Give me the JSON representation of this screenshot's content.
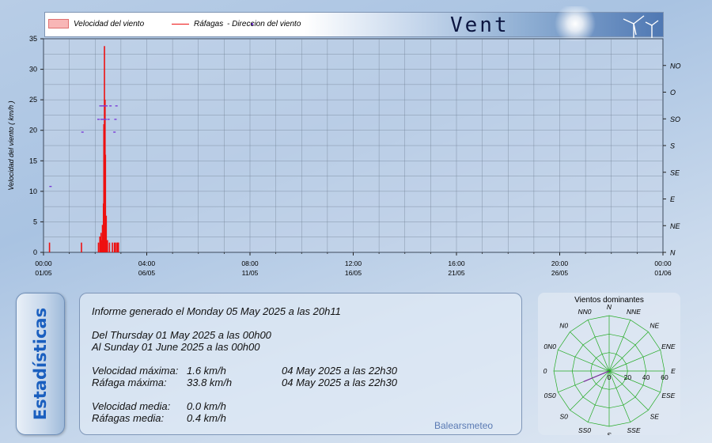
{
  "header": {
    "title": "Vent",
    "legend": {
      "speed_label": "Velocidad del viento",
      "gust_label": "Ráfagas",
      "dir_label": "- Direccion del viento"
    }
  },
  "colors": {
    "speed": "#f4a0a0",
    "gust": "#ee1111",
    "direction": "#7a3cd8",
    "grid": "#6f7f93",
    "rose_grid": "#22aa22",
    "rose_fill": "#c88bb8",
    "title_accent": "#1a5fbf"
  },
  "chart_data": [
    {
      "type": "bar",
      "ylabel": "Velocidad del viento ( km/h )",
      "ylim": [
        0,
        35
      ],
      "y_ticks": [
        "0",
        "5",
        "10",
        "15",
        "20",
        "25",
        "30",
        "35"
      ],
      "x_ticks": [
        {
          "time": "00:00",
          "date": "01/05"
        },
        {
          "time": "04:00",
          "date": "06/05"
        },
        {
          "time": "08:00",
          "date": "11/05"
        },
        {
          "time": "12:00",
          "date": "16/05"
        },
        {
          "time": "16:00",
          "date": "21/05"
        },
        {
          "time": "20:00",
          "date": "26/05"
        },
        {
          "time": "00:00",
          "date": "01/06"
        }
      ],
      "x_range_days": [
        0,
        31
      ],
      "right_axis_labels": [
        "N",
        "NE",
        "E",
        "SE",
        "S",
        "SO",
        "O",
        "NO"
      ],
      "grid": true,
      "gusts": [
        {
          "day": 0.3,
          "value": 1.6
        },
        {
          "day": 1.9,
          "value": 1.6
        },
        {
          "day": 2.75,
          "value": 1.6
        },
        {
          "day": 2.82,
          "value": 2.6
        },
        {
          "day": 2.88,
          "value": 3.2
        },
        {
          "day": 2.92,
          "value": 2.0
        },
        {
          "day": 2.95,
          "value": 4.5
        },
        {
          "day": 3.0,
          "value": 8.0
        },
        {
          "day": 3.02,
          "value": 21.0
        },
        {
          "day": 3.05,
          "value": 33.8
        },
        {
          "day": 3.08,
          "value": 25.0
        },
        {
          "day": 3.1,
          "value": 16.0
        },
        {
          "day": 3.14,
          "value": 6.0
        },
        {
          "day": 3.2,
          "value": 2.0
        },
        {
          "day": 3.3,
          "value": 1.6
        },
        {
          "day": 3.45,
          "value": 1.6
        },
        {
          "day": 3.55,
          "value": 1.6
        },
        {
          "day": 3.6,
          "value": 1.6
        },
        {
          "day": 3.68,
          "value": 1.6
        },
        {
          "day": 3.72,
          "value": 1.6
        },
        {
          "day": 3.75,
          "value": 1.6
        }
      ],
      "speed": [
        {
          "day": 3.02,
          "value": 1.2
        },
        {
          "day": 3.05,
          "value": 1.6
        },
        {
          "day": 3.08,
          "value": 1.0
        }
      ],
      "direction_points": [
        {
          "day": 0.35,
          "value": 10.8
        },
        {
          "day": 1.95,
          "value": 19.7
        },
        {
          "day": 2.75,
          "value": 21.8
        },
        {
          "day": 2.85,
          "value": 24.0
        },
        {
          "day": 2.9,
          "value": 21.8
        },
        {
          "day": 2.95,
          "value": 24.0
        },
        {
          "day": 3.0,
          "value": 21.8
        },
        {
          "day": 3.05,
          "value": 24.0
        },
        {
          "day": 3.1,
          "value": 21.8
        },
        {
          "day": 3.15,
          "value": 24.0
        },
        {
          "day": 3.25,
          "value": 21.8
        },
        {
          "day": 3.35,
          "value": 24.0
        },
        {
          "day": 3.55,
          "value": 19.7
        },
        {
          "day": 3.6,
          "value": 21.8
        },
        {
          "day": 3.65,
          "value": 24.0
        }
      ]
    },
    {
      "type": "radar",
      "title": "Vientos dominantes",
      "directions": [
        "N",
        "NNE",
        "NE",
        "ENE",
        "E",
        "ESE",
        "SE",
        "SSE",
        "S",
        "SS0",
        "S0",
        "0S0",
        "0",
        "0N0",
        "N0",
        "NN0"
      ],
      "rings": [
        "0",
        "20",
        "40",
        "60"
      ],
      "rmax": 60,
      "values": [
        0,
        0,
        0,
        0,
        0,
        0,
        0,
        0,
        0,
        0,
        0,
        30,
        0,
        0,
        0,
        0
      ]
    }
  ],
  "stats": {
    "tab_label": "Estadísticas",
    "generated": "Informe generado el Monday 05 May 2025 a las 20h11",
    "from": "Del Thursday 01 May 2025 a las 00h00",
    "to": "Al Sunday 01 June 2025 a las 00h00",
    "max_speed_label": "Velocidad máxima:",
    "max_speed_value": "1.6 km/h",
    "max_speed_time": "04 May 2025 a las 22h30",
    "max_gust_label": "Ráfaga máxima:",
    "max_gust_value": "33.8 km/h",
    "max_gust_time": "04 May 2025 a las 22h30",
    "avg_speed_label": "Velocidad media:",
    "avg_speed_value": "0.0 km/h",
    "avg_gust_label": "Ráfagas media:",
    "avg_gust_value": "0.4 km/h",
    "brand": "Balearsmeteo"
  }
}
